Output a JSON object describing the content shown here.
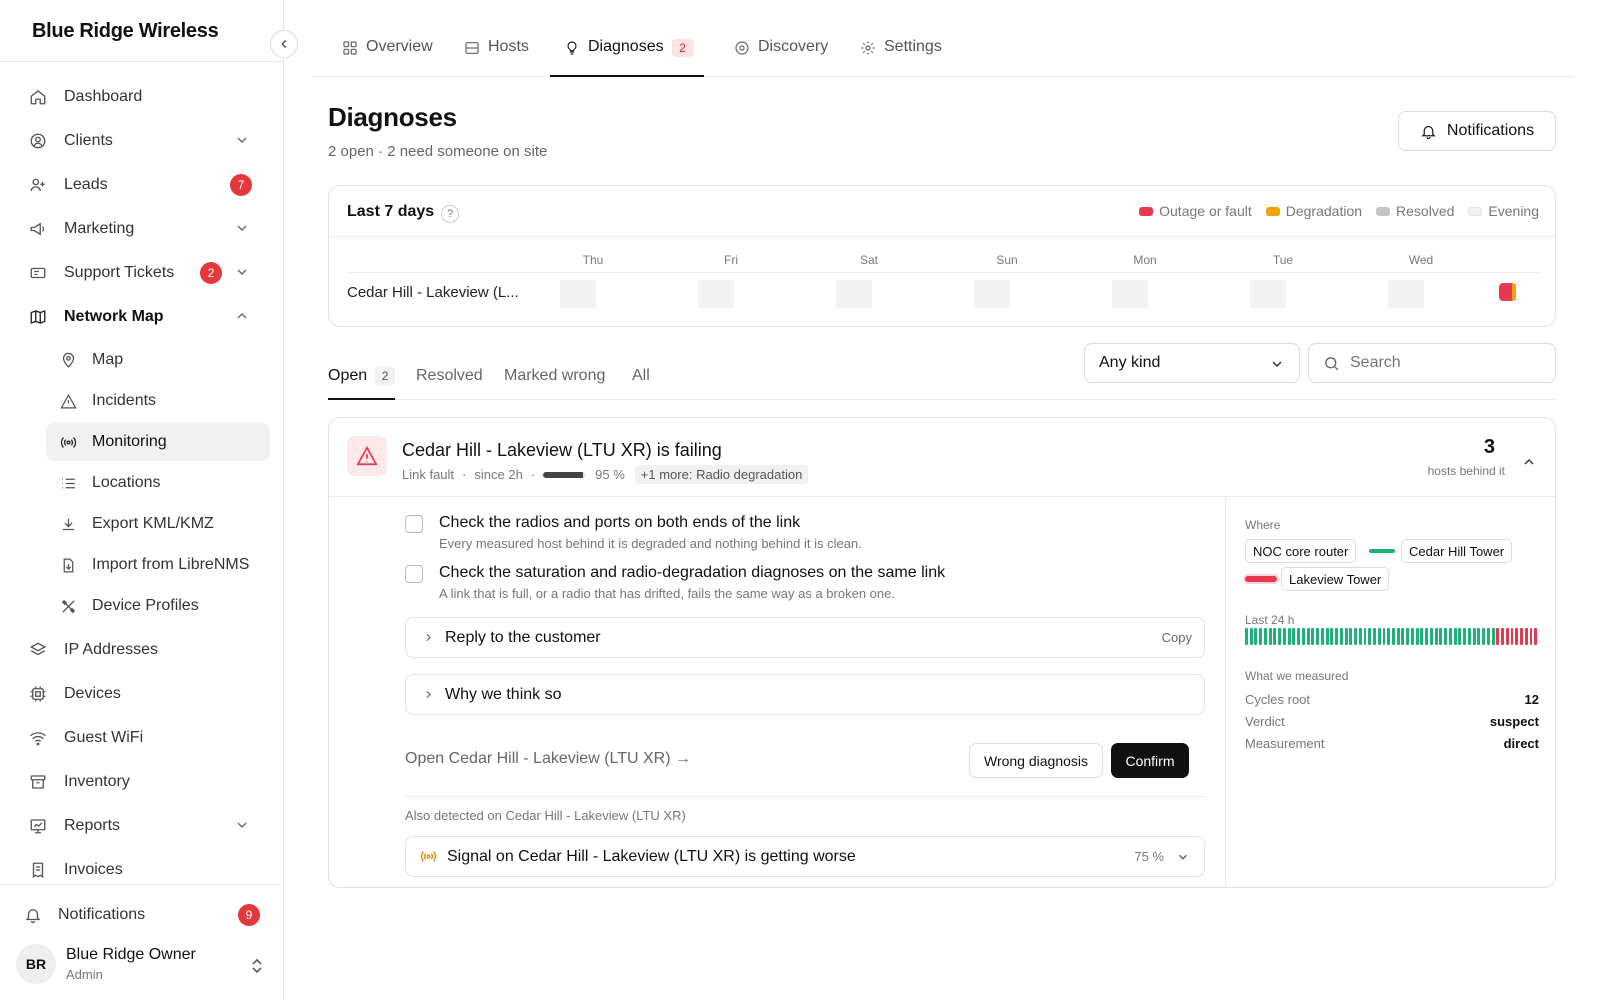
{
  "brand": "Blue Ridge Wireless",
  "sidebar": {
    "items": [
      {
        "label": "Dashboard",
        "icon": "home-icon"
      },
      {
        "label": "Clients",
        "icon": "user-circle-icon",
        "chevron": "down"
      },
      {
        "label": "Leads",
        "icon": "user-plus-icon",
        "badge": "7"
      },
      {
        "label": "Marketing",
        "icon": "megaphone-icon",
        "chevron": "down"
      },
      {
        "label": "Support Tickets",
        "icon": "ticket-icon",
        "badge": "2",
        "chevron": "down"
      },
      {
        "label": "Network Map",
        "icon": "map-icon",
        "chevron": "up"
      },
      {
        "label": "Map",
        "icon": "pin-icon"
      },
      {
        "label": "Incidents",
        "icon": "warning-icon"
      },
      {
        "label": "Monitoring",
        "icon": "broadcast-icon"
      },
      {
        "label": "Locations",
        "icon": "list-icon"
      },
      {
        "label": "Export KML/KMZ",
        "icon": "download-icon"
      },
      {
        "label": "Import from LibreNMS",
        "icon": "import-icon"
      },
      {
        "label": "Device Profiles",
        "icon": "tools-icon"
      },
      {
        "label": "IP Addresses",
        "icon": "layers-icon"
      },
      {
        "label": "Devices",
        "icon": "chip-icon"
      },
      {
        "label": "Guest WiFi",
        "icon": "wifi-icon"
      },
      {
        "label": "Inventory",
        "icon": "archive-icon"
      },
      {
        "label": "Reports",
        "icon": "report-icon",
        "chevron": "down"
      },
      {
        "label": "Invoices",
        "icon": "invoice-icon"
      }
    ],
    "notifications_label": "Notifications",
    "notifications_badge": "9",
    "user": {
      "initials": "BR",
      "name": "Blue Ridge Owner",
      "role": "Admin"
    }
  },
  "tabs": [
    {
      "label": "Overview",
      "icon": "grid-icon"
    },
    {
      "label": "Hosts",
      "icon": "server-icon"
    },
    {
      "label": "Diagnoses",
      "icon": "lightbulb-icon",
      "badge": "2",
      "active": true
    },
    {
      "label": "Discovery",
      "icon": "radar-icon"
    },
    {
      "label": "Settings",
      "icon": "gear-icon"
    }
  ],
  "page": {
    "title": "Diagnoses",
    "subtitle": "2 open · 2 need someone on site",
    "notifications_button": "Notifications"
  },
  "timeline": {
    "title": "Last 7 days",
    "help": "?",
    "legend": [
      {
        "label": "Outage or fault",
        "color": "#e63950"
      },
      {
        "label": "Degradation",
        "color": "#f0a30a"
      },
      {
        "label": "Resolved",
        "color": "#c4c4c4"
      },
      {
        "label": "Evening",
        "color": "#f1f1f1"
      }
    ],
    "days": [
      "Thu",
      "Fri",
      "Sat",
      "Sun",
      "Mon",
      "Tue",
      "Wed"
    ],
    "rows": [
      {
        "label": "Cedar Hill - Lakeview (L...",
        "events_on": "Wed",
        "kinds": [
          "Outage or fault",
          "Degradation"
        ]
      }
    ]
  },
  "filters": {
    "tabs": [
      {
        "label": "Open",
        "count": "2",
        "active": true
      },
      {
        "label": "Resolved"
      },
      {
        "label": "Marked wrong"
      },
      {
        "label": "All"
      }
    ],
    "kind_select": "Any kind",
    "search_placeholder": "Search"
  },
  "diagnosis": {
    "title": "Cedar Hill - Lakeview (LTU XR) is failing",
    "kind": "Link fault",
    "since": "since 2h",
    "confidence": "95 %",
    "confidence_value": 0.95,
    "more": "+1 more: Radio degradation",
    "hosts_count": "3",
    "hosts_label": "hosts behind it",
    "checks": [
      {
        "title": "Check the radios and ports on both ends of the link",
        "sub": "Every measured host behind it is degraded and nothing behind it is clean."
      },
      {
        "title": "Check the saturation and radio-degradation diagnoses on the same link",
        "sub": "A link that is full, or a radio that has drifted, fails the same way as a broken one."
      }
    ],
    "reply_label": "Reply to the customer",
    "copy_label": "Copy",
    "why_label": "Why we think so",
    "open_link": "Open Cedar Hill - Lakeview (LTU XR) →",
    "wrong_button": "Wrong diagnosis",
    "confirm_button": "Confirm",
    "also_label": "Also detected on Cedar Hill - Lakeview (LTU XR)",
    "also_item": {
      "title": "Signal on Cedar Hill - Lakeview (LTU XR) is getting worse",
      "confidence": "75 %"
    },
    "where_label": "Where",
    "where_nodes": [
      "NOC core router",
      "Cedar Hill Tower",
      "Lakeview Tower"
    ],
    "where_links": [
      {
        "from": "NOC core router",
        "to": "Cedar Hill Tower",
        "status": "ok",
        "color": "#1db27a"
      },
      {
        "from": "Cedar Hill Tower",
        "to": "Lakeview Tower",
        "status": "failing",
        "color": "#e63950"
      }
    ],
    "last24_label": "Last 24 h",
    "last24_bars": [
      "ok",
      "ok",
      "ok",
      "ok",
      "ok",
      "ok",
      "ok",
      "ok",
      "ok",
      "ok",
      "ok",
      "ok",
      "ok",
      "ok",
      "ok",
      "ok",
      "ok",
      "ok",
      "ok",
      "ok",
      "ok",
      "ok",
      "ok",
      "ok",
      "ok",
      "ok",
      "ok",
      "ok",
      "ok",
      "ok",
      "ok",
      "ok",
      "ok",
      "ok",
      "ok",
      "ok",
      "ok",
      "ok",
      "ok",
      "ok",
      "ok",
      "ok",
      "ok",
      "ok",
      "ok",
      "ok",
      "ok",
      "ok",
      "ok",
      "ok",
      "ok",
      "ok",
      "ok",
      "fail",
      "fail",
      "fail",
      "fail",
      "fail",
      "fail",
      "fail",
      "fail",
      "fail"
    ],
    "status_colors": {
      "ok": "#1db27a",
      "fail": "#e63950"
    },
    "measured_label": "What we measured",
    "measured": [
      {
        "key": "Cycles root",
        "value": "12"
      },
      {
        "key": "Verdict",
        "value": "suspect"
      },
      {
        "key": "Measurement",
        "value": "direct"
      }
    ]
  }
}
